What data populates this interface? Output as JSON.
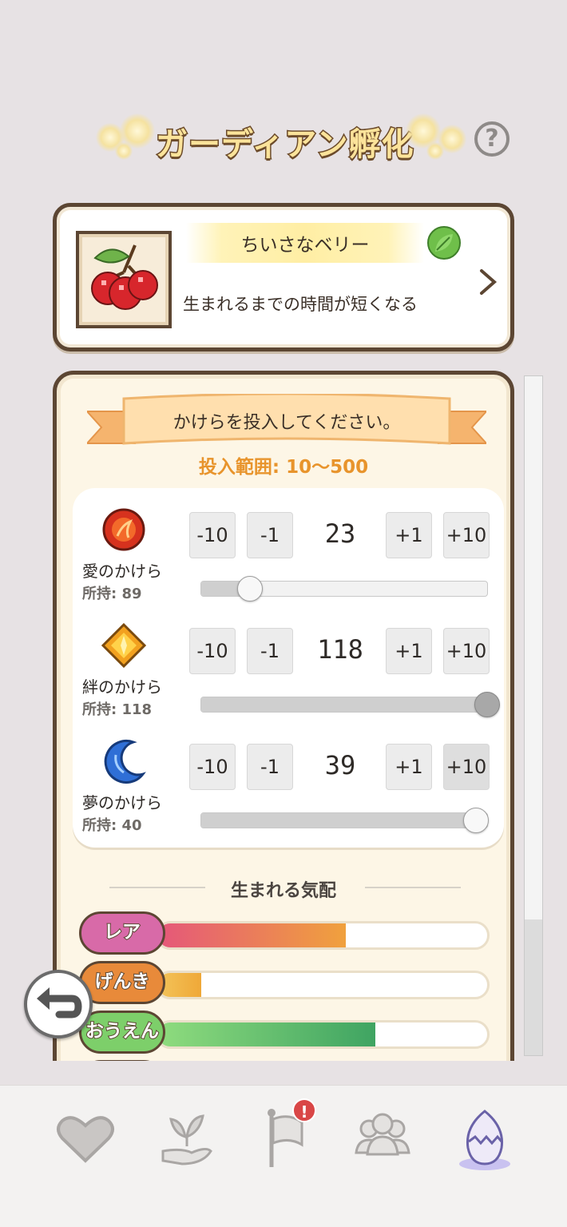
{
  "header": {
    "title": "ガーディアン孵化",
    "help_label": "?"
  },
  "item": {
    "icon": "cherry-icon",
    "name": "ちいさなベリー",
    "badge_icon": "leaf-icon",
    "description": "生まれるまでの時間が短くなる"
  },
  "panel": {
    "instruction": "かけらを投入してください。",
    "range": "投入範囲: 10〜500",
    "step_labels": {
      "minus10": "-10",
      "minus1": "-1",
      "plus1": "+1",
      "plus10": "+10"
    },
    "fragments": [
      {
        "name": "愛のかけら",
        "owned": "所持: 89",
        "value": "23",
        "slider_ratio": 0.17,
        "icon": "red-orb-icon",
        "color": "#d7321e"
      },
      {
        "name": "絆のかけら",
        "owned": "所持: 118",
        "value": "118",
        "slider_ratio": 1.0,
        "icon": "orange-diamond-icon",
        "color": "#f2a11f"
      },
      {
        "name": "夢のかけら",
        "owned": "所持: 40",
        "value": "39",
        "slider_ratio": 0.96,
        "icon": "blue-moon-icon",
        "color": "#2f6fd6"
      }
    ],
    "signs_title": "生まれる気配",
    "traits": [
      {
        "label": "レア",
        "level": 0.57,
        "pill_color": "#d86aa8",
        "fill_from": "#e5577a",
        "fill_to": "#f0a13d"
      },
      {
        "label": "げんき",
        "level": 0.13,
        "pill_color": "#e88a3a",
        "fill_from": "#f3c45a",
        "fill_to": "#efa838"
      },
      {
        "label": "おうえん",
        "level": 0.66,
        "pill_color": "#7dcf6a",
        "fill_from": "#8fdc7e",
        "fill_to": "#3fa462"
      },
      {
        "label": "",
        "level": 0,
        "pill_color": "#5a9be0",
        "fill_from": "#8ab8ec",
        "fill_to": "#5a9be0"
      }
    ]
  },
  "nav": {
    "items": [
      "heart-icon",
      "sprout-hand-icon",
      "flag-icon",
      "group-icon",
      "egg-icon"
    ],
    "flag_badge": "!",
    "active": "egg-icon"
  },
  "colors": {
    "accent": "#e8942c",
    "frame": "#5c4633",
    "panel_bg": "#fdf6e6",
    "page_bg": "#e7e2e4"
  }
}
